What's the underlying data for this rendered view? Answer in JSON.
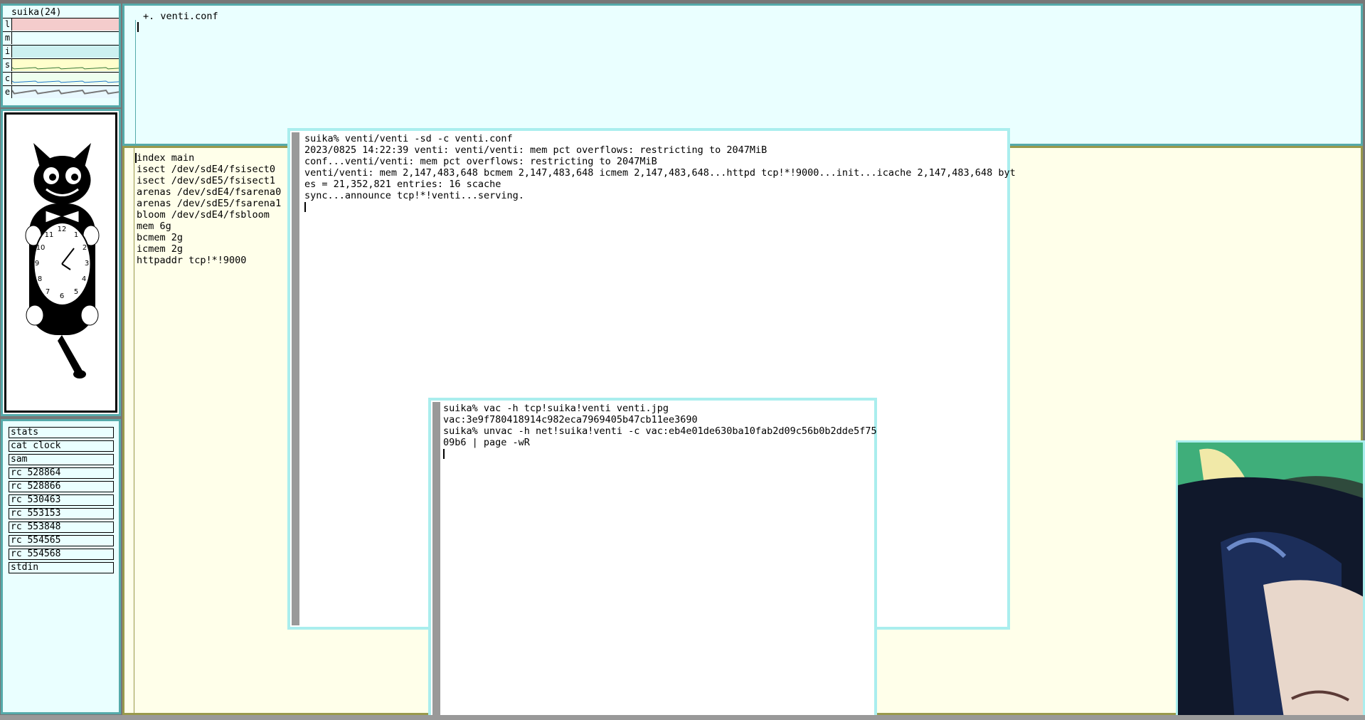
{
  "stats": {
    "title": "suika(24)",
    "rows": [
      {
        "letter": "l",
        "color": "#f4cccc"
      },
      {
        "letter": "m",
        "color": "#eaffff"
      },
      {
        "letter": "i",
        "color": "#ccf0f0"
      },
      {
        "letter": "s",
        "color": "#ffffcc"
      },
      {
        "letter": "c",
        "color": "#eeffee"
      },
      {
        "letter": "e",
        "color": "#e8f8ff"
      }
    ]
  },
  "clock": {
    "app": "cat clock"
  },
  "winlist": {
    "items": [
      "stats",
      "cat clock",
      "sam",
      "rc 528864",
      "rc 528866",
      "rc 530463",
      "rc 553153",
      "rc 553848",
      "rc 554565",
      "rc 554568",
      "stdin"
    ]
  },
  "acme_top": {
    "tag": "+. venti.conf"
  },
  "acme_main": {
    "lines": [
      "index main",
      "isect /dev/sdE4/fsisect0",
      "isect /dev/sdE5/fsisect1",
      "arenas /dev/sdE4/fsarena0",
      "arenas /dev/sdE5/fsarena1",
      "bloom /dev/sdE4/fsbloom",
      "mem 6g",
      "bcmem 2g",
      "icmem 2g",
      "httpaddr tcp!*!9000"
    ]
  },
  "venti_term": {
    "lines": [
      "suika% venti/venti -sd -c venti.conf",
      "2023/0825 14:22:39 venti: venti/venti: mem pct overflows: restricting to 2047MiB",
      "conf...venti/venti: mem pct overflows: restricting to 2047MiB",
      "venti/venti: mem 2,147,483,648 bcmem 2,147,483,648 icmem 2,147,483,648...httpd tcp!*!9000...init...icache 2,147,483,648 byt",
      "es = 21,352,821 entries: 16 scache",
      "sync...announce tcp!*!venti...serving."
    ]
  },
  "vac_term": {
    "lines": [
      "suika% vac -h tcp!suika!venti venti.jpg",
      "vac:3e9f780418914c982eca7969405b47cb11ee3690",
      "suika% unvac -h net!suika!venti -c vac:eb4e01de630ba10fab2d09c56b0b2dde5f75",
      "09b6 | page -wR"
    ]
  }
}
